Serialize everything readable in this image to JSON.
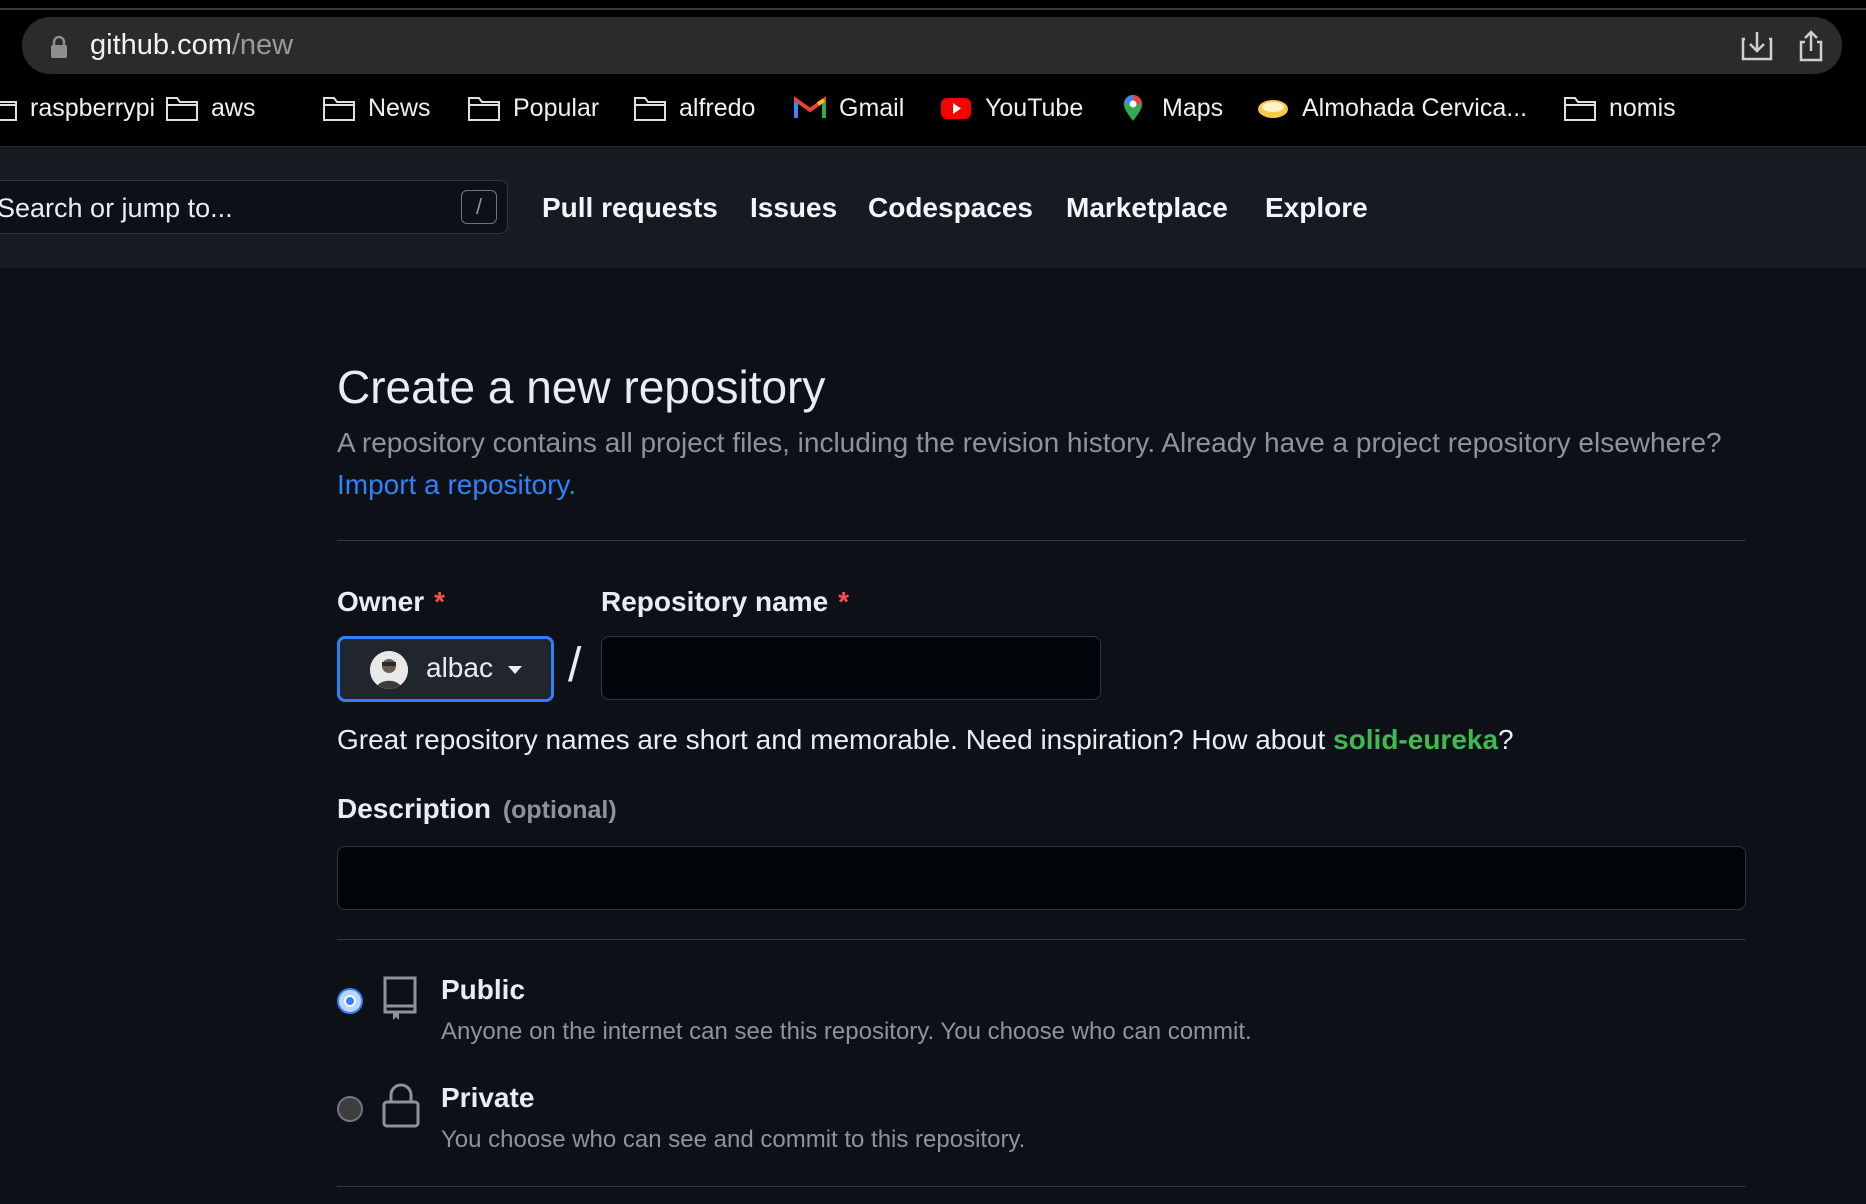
{
  "browser": {
    "url_host": "github.com",
    "url_path": "/new",
    "bookmarks": [
      {
        "label": "raspberrypi",
        "icon": "folder-icon"
      },
      {
        "label": "aws",
        "icon": "folder-icon"
      },
      {
        "label": "News",
        "icon": "folder-icon"
      },
      {
        "label": "Popular",
        "icon": "folder-icon"
      },
      {
        "label": "alfredo",
        "icon": "folder-icon"
      },
      {
        "label": "Gmail",
        "icon": "gmail-icon"
      },
      {
        "label": "YouTube",
        "icon": "youtube-icon"
      },
      {
        "label": "Maps",
        "icon": "maps-pin-icon"
      },
      {
        "label": "Almohada Cervica...",
        "icon": "pillow-icon"
      },
      {
        "label": "nomis",
        "icon": "folder-icon"
      }
    ]
  },
  "header": {
    "search_placeholder": "Search or jump to...",
    "search_shortcut": "/",
    "nav": [
      "Pull requests",
      "Issues",
      "Codespaces",
      "Marketplace",
      "Explore"
    ]
  },
  "page": {
    "title": "Create a new repository",
    "description": "A repository contains all project files, including the revision history. Already have a project repository elsewhere?",
    "import_link": "Import a repository.",
    "owner_label": "Owner",
    "repo_name_label": "Repository name",
    "required_mark": "*",
    "owner_value": "albac",
    "separator": "/",
    "repo_name_value": "",
    "name_hint_prefix": "Great repository names are short and memorable. Need inspiration? How about ",
    "name_suggestion": "solid-eureka",
    "name_hint_suffix": "?",
    "description_label": "Description",
    "description_optional": "(optional)",
    "description_value": "",
    "visibility": [
      {
        "title": "Public",
        "desc": "Anyone on the internet can see this repository. You choose who can commit.",
        "selected": true
      },
      {
        "title": "Private",
        "desc": "You choose who can see and commit to this repository.",
        "selected": false
      }
    ]
  },
  "colors": {
    "background": "#0d1117",
    "header": "#161b22",
    "accent_blue": "#2f81f7",
    "suggestion_green": "#3fb950",
    "required_red": "#f85149"
  }
}
